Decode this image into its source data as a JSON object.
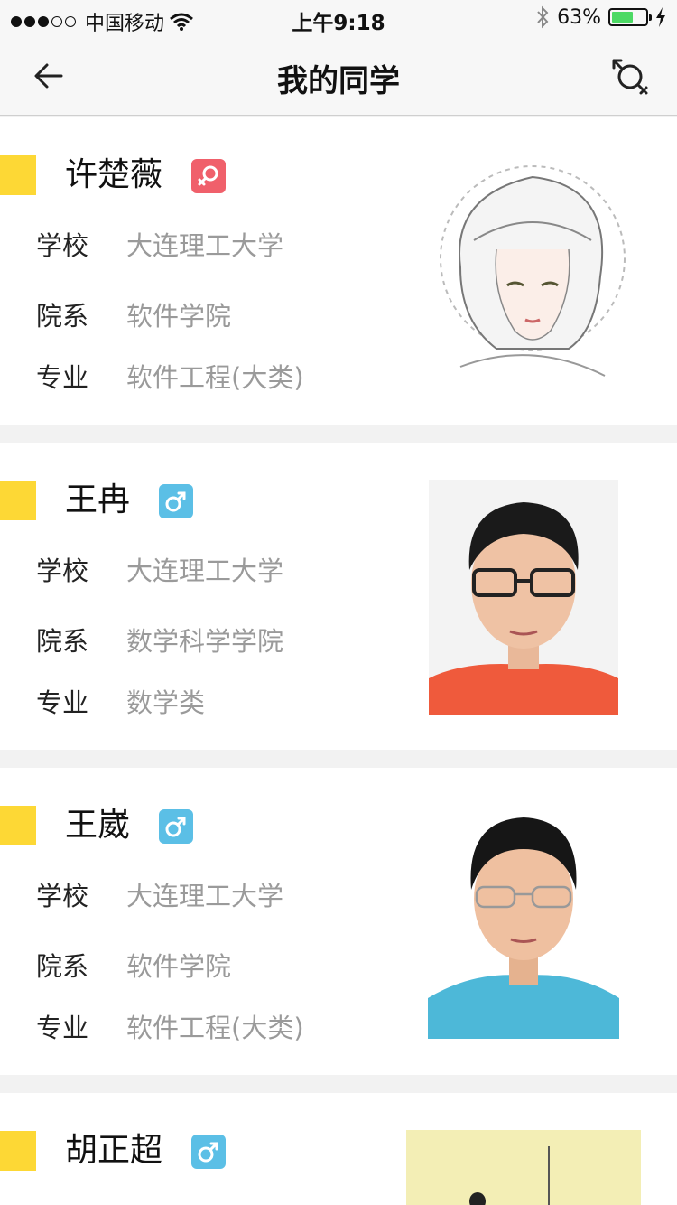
{
  "status_bar": {
    "carrier": "中国移动",
    "time": "上午9:18",
    "battery": "63%",
    "battery_level": 0.63
  },
  "nav": {
    "title": "我的同学",
    "back_icon": "arrow-left-icon",
    "gender_filter_icon": "gender-switch-icon"
  },
  "labels": {
    "school": "学校",
    "department": "院系",
    "major": "专业"
  },
  "classmates": [
    {
      "name": "许楚薇",
      "gender": "female",
      "school": "大连理工大学",
      "department": "软件学院",
      "major": "软件工程(大类)"
    },
    {
      "name": "王冉",
      "gender": "male",
      "school": "大连理工大学",
      "department": "数学科学学院",
      "major": "数学类"
    },
    {
      "name": "王崴",
      "gender": "male",
      "school": "大连理工大学",
      "department": "软件学院",
      "major": "软件工程(大类)"
    },
    {
      "name": "胡正超",
      "gender": "male"
    }
  ],
  "colors": {
    "marker": "#fdd835",
    "female": "#f0606b",
    "male": "#5bbfe6"
  }
}
